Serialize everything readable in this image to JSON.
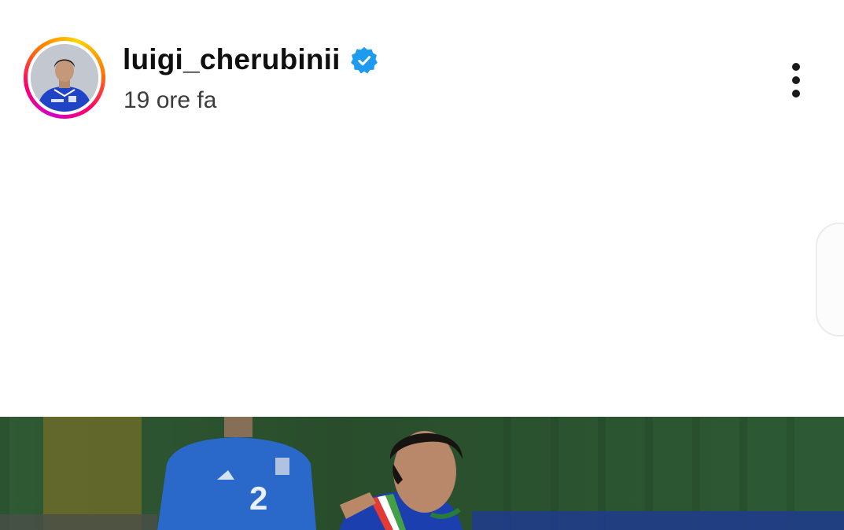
{
  "post": {
    "username": "luigi_cherubinii",
    "verified": true,
    "time_ago": "19 ore fa"
  },
  "icons": {
    "verified": "verified-badge-icon",
    "more": "more-vertical-icon"
  },
  "colors": {
    "verified_blue": "#1d9bf0",
    "story_ring": [
      "#d300c5",
      "#ff0069",
      "#ff7a00",
      "#ffd600"
    ],
    "text_primary": "#0f0f0f",
    "text_secondary": "#3c3c3c"
  }
}
